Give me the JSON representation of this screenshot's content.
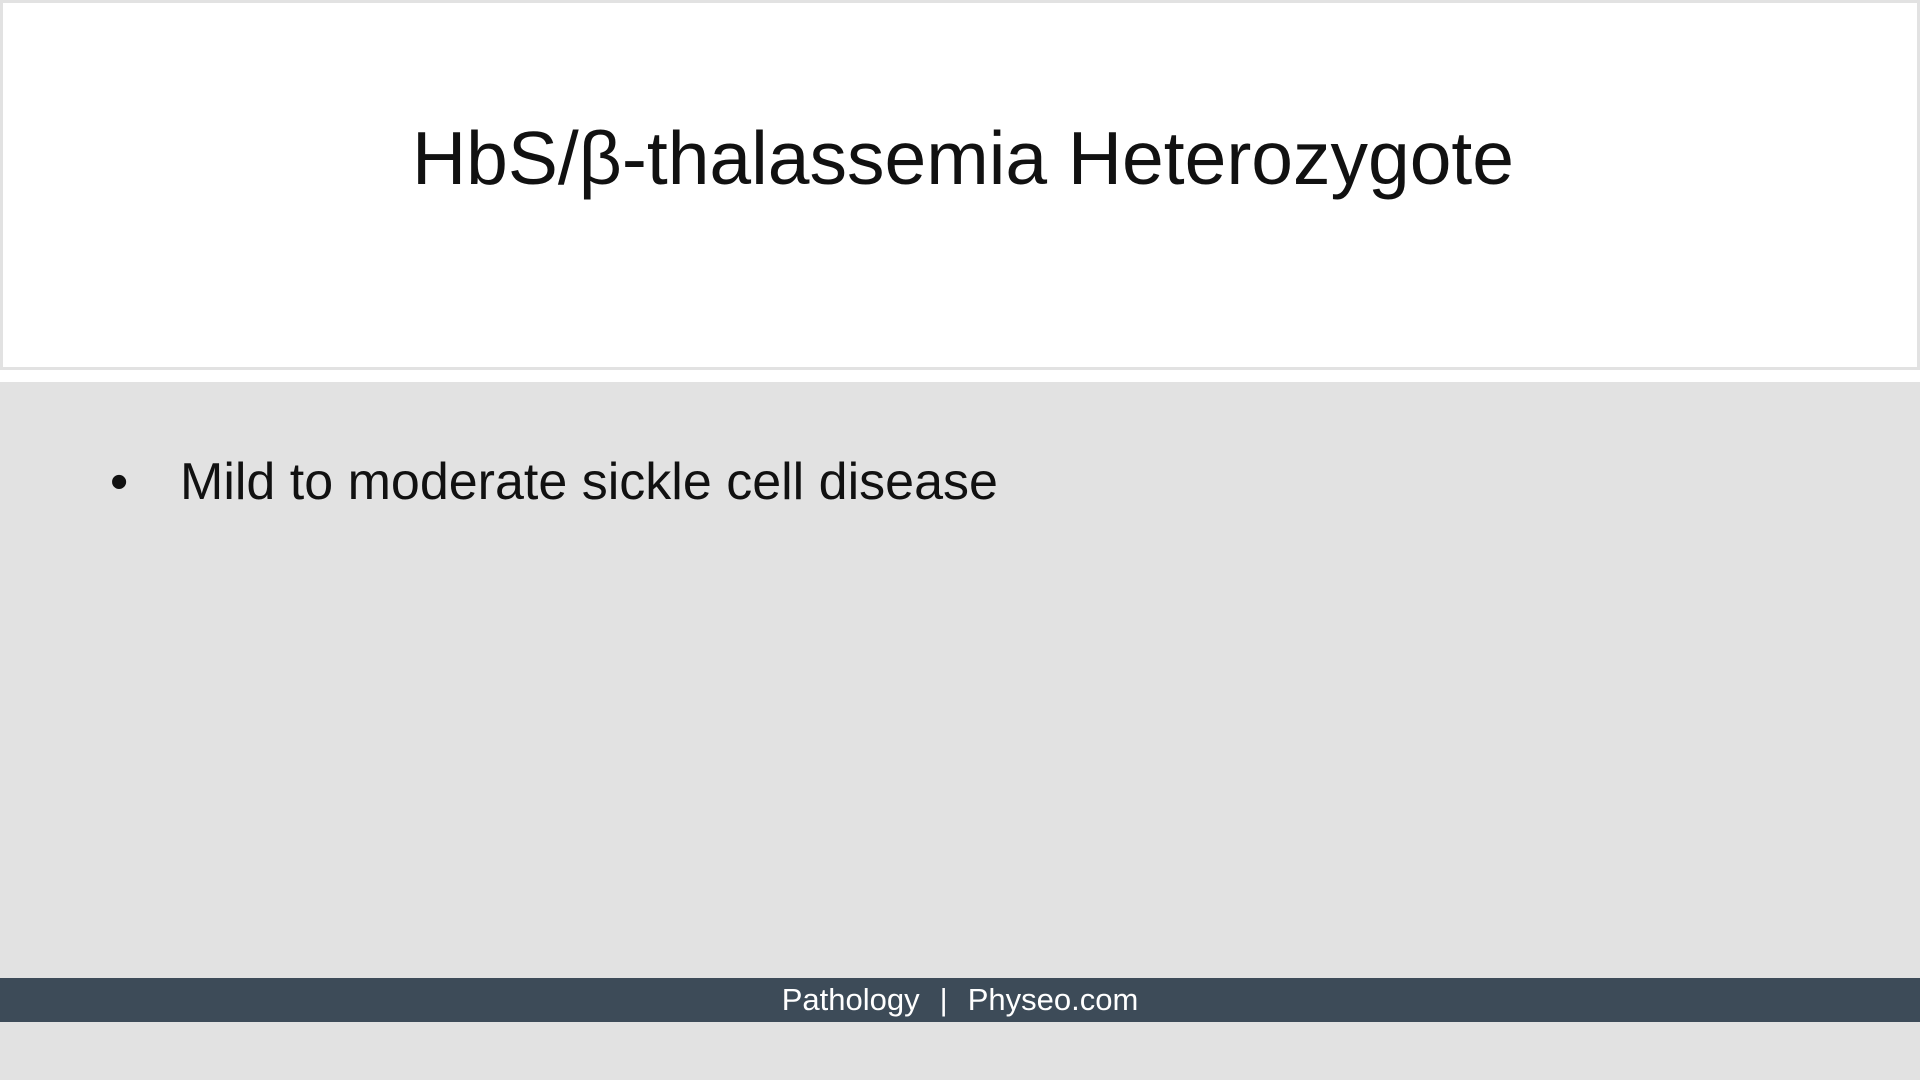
{
  "slide": {
    "title": "HbS/β-thalassemia Heterozygote",
    "bullets": [
      "Mild to moderate sickle cell disease"
    ],
    "bullet_symbol": "•"
  },
  "footer": {
    "left": "Pathology",
    "separator": "|",
    "right": "Physeo.com"
  },
  "colors": {
    "background": "#e2e2e2",
    "title_panel": "#ffffff",
    "footer_bar": "#3d4b58",
    "text": "#111111",
    "footer_text": "#ffffff"
  }
}
